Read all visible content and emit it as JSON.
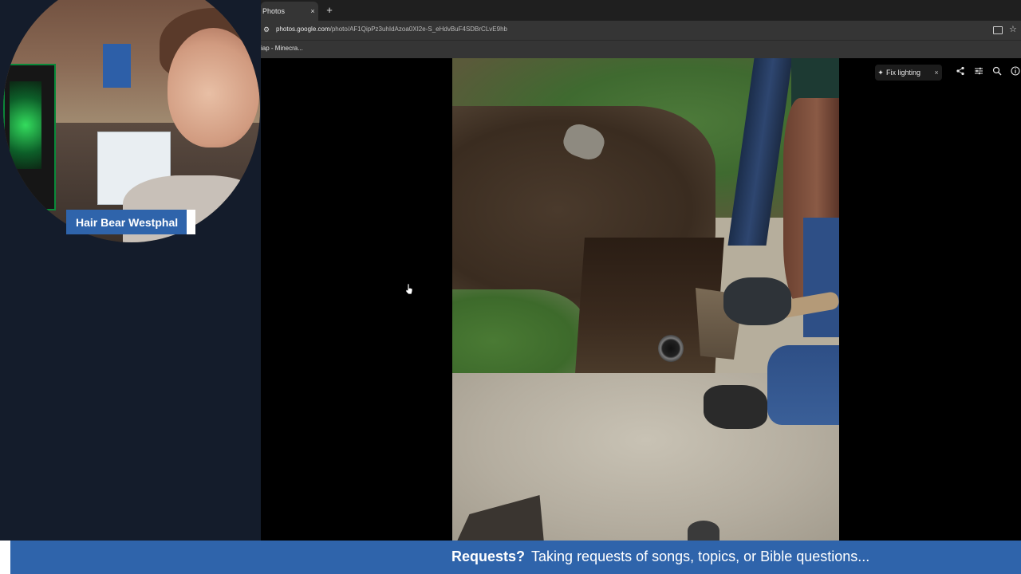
{
  "overlay": {
    "name": "Hair Bear Westphal"
  },
  "browser": {
    "tab": {
      "title": "Photos",
      "close": "×"
    },
    "new_tab": "+",
    "url": {
      "host": "photos.google.com",
      "path": "/photo/AF1QipPz3uhIdAzoa0XI2e-S_eHdvBuF4SDBrCLvE9hb"
    },
    "bookmark": "iap - Minecra..."
  },
  "viewer": {
    "fix_lighting": "Fix lighting",
    "fix_close": "×",
    "icons": [
      "sparkle-icon",
      "share-icon",
      "edit-adjust-icon",
      "zoom-icon",
      "info-icon"
    ]
  },
  "banner": {
    "lead": "Requests?",
    "text": "Taking requests of songs, topics, or Bible questions..."
  },
  "colors": {
    "banner": "#2f64ab",
    "sidebar_bg": "#141c2b",
    "viewer_bg": "#000000"
  }
}
